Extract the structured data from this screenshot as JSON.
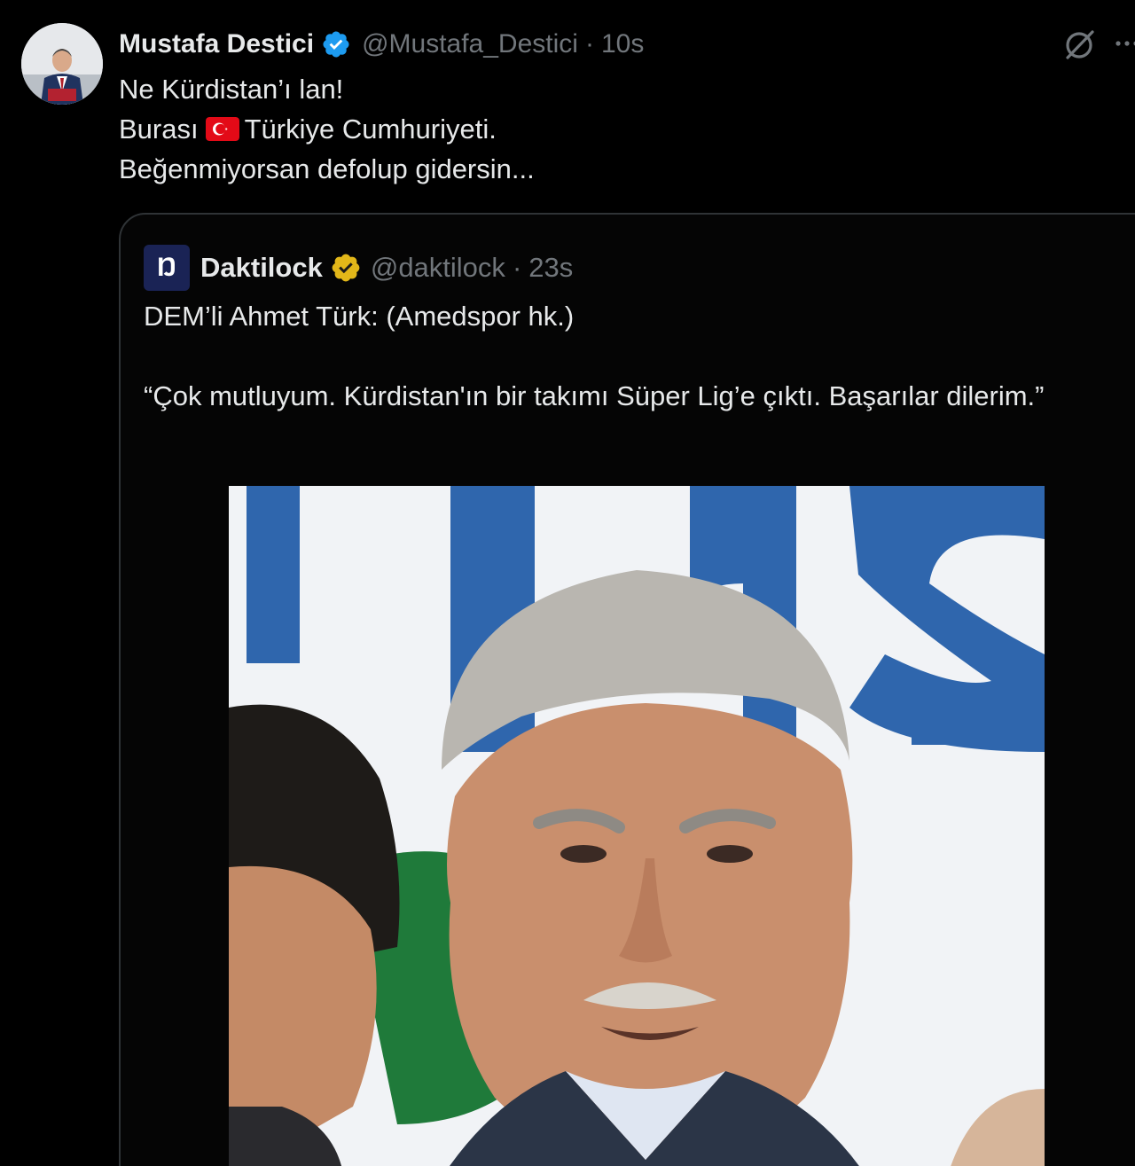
{
  "post": {
    "author_name": "Mustafa Destici",
    "handle": "@Mustafa_Destici",
    "separator": "·",
    "time": "10s",
    "lines": [
      "Ne Kürdistan’ı lan!",
      "Burası",
      "Türkiye Cumhuriyeti.",
      "Beğenmiyorsan defolup gidersin..."
    ]
  },
  "quoted": {
    "author_name": "Daktilock",
    "handle": "@daktilock",
    "separator": "·",
    "time": "23s",
    "lines": [
      "DEM’li Ahmet Türk: (Amedspor hk.)",
      "“Çok mutluyum. Kürdistan'ın bir takımı Süper Lig’e çıktı. Başarılar dilerim.”"
    ],
    "avatar_glyph": "Ŋ"
  },
  "colors": {
    "background": "#000000",
    "text": "#e7e9ea",
    "muted": "#71767b",
    "verified_blue": "#1d9bf0",
    "verified_gold": "#e2b719",
    "border": "#2f3336",
    "flag_red": "#e30a17"
  },
  "icons": {
    "verified": "verified-badge-icon",
    "quoted_verified": "gold-verified-badge-icon",
    "grok": "grok-icon",
    "more": "more-icon",
    "flag": "turkey-flag-icon"
  }
}
